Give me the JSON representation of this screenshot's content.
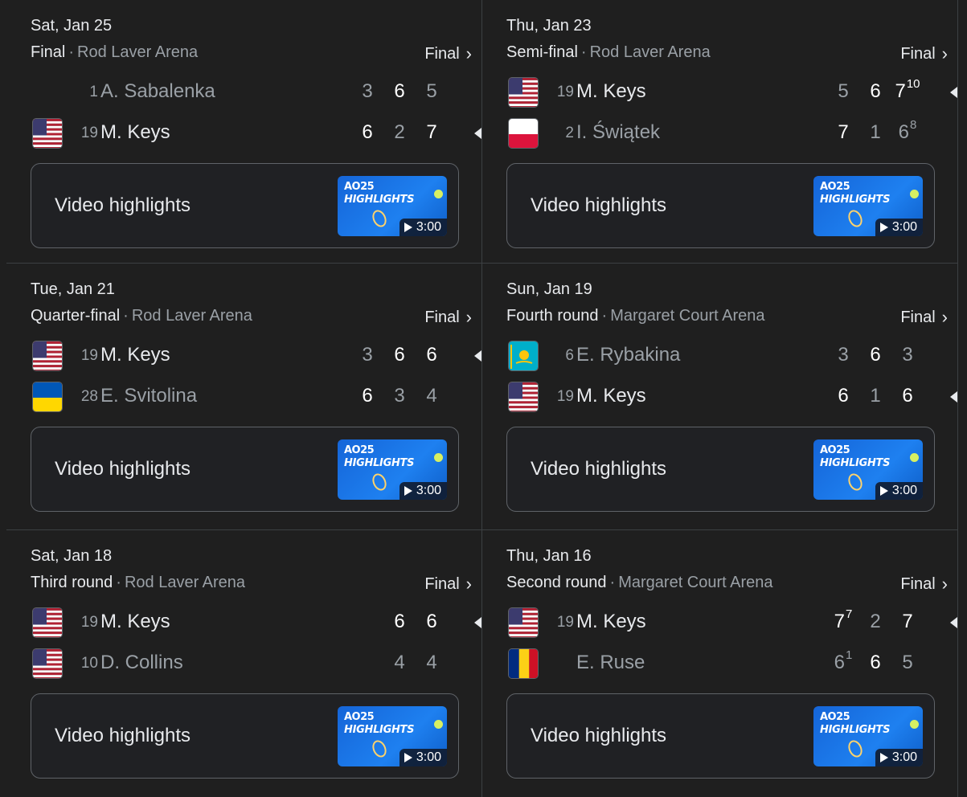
{
  "matches": [
    {
      "date": "Sat, Jan 25",
      "round": "Final",
      "venue": "Rod Laver Arena",
      "status": "Final",
      "players": [
        {
          "flag": "none",
          "seed": "1",
          "name": "A. Sabalenka",
          "winner": false,
          "sets": [
            {
              "v": "3",
              "w": false,
              "tb": ""
            },
            {
              "v": "6",
              "w": true,
              "tb": ""
            },
            {
              "v": "5",
              "w": false,
              "tb": ""
            }
          ]
        },
        {
          "flag": "usa",
          "seed": "19",
          "name": "M. Keys",
          "winner": true,
          "sets": [
            {
              "v": "6",
              "w": true,
              "tb": ""
            },
            {
              "v": "2",
              "w": false,
              "tb": ""
            },
            {
              "v": "7",
              "w": true,
              "tb": ""
            }
          ]
        }
      ],
      "highlights": {
        "label": "Video highlights",
        "badge": "AO25",
        "title": "HIGHLIGHTS",
        "duration": "3:00"
      }
    },
    {
      "date": "Thu, Jan 23",
      "round": "Semi-final",
      "venue": "Rod Laver Arena",
      "status": "Final",
      "players": [
        {
          "flag": "usa",
          "seed": "19",
          "name": "M. Keys",
          "winner": true,
          "sets": [
            {
              "v": "5",
              "w": false,
              "tb": ""
            },
            {
              "v": "6",
              "w": true,
              "tb": ""
            },
            {
              "v": "7",
              "w": true,
              "tb": "10"
            }
          ]
        },
        {
          "flag": "poland",
          "seed": "2",
          "name": "I. Świątek",
          "winner": false,
          "sets": [
            {
              "v": "7",
              "w": true,
              "tb": ""
            },
            {
              "v": "1",
              "w": false,
              "tb": ""
            },
            {
              "v": "6",
              "w": false,
              "tb": "8"
            }
          ]
        }
      ],
      "highlights": {
        "label": "Video highlights",
        "badge": "AO25",
        "title": "HIGHLIGHTS",
        "duration": "3:00"
      }
    },
    {
      "date": "Tue, Jan 21",
      "round": "Quarter-final",
      "venue": "Rod Laver Arena",
      "status": "Final",
      "players": [
        {
          "flag": "usa",
          "seed": "19",
          "name": "M. Keys",
          "winner": true,
          "sets": [
            {
              "v": "3",
              "w": false,
              "tb": ""
            },
            {
              "v": "6",
              "w": true,
              "tb": ""
            },
            {
              "v": "6",
              "w": true,
              "tb": ""
            }
          ]
        },
        {
          "flag": "ukraine",
          "seed": "28",
          "name": "E. Svitolina",
          "winner": false,
          "sets": [
            {
              "v": "6",
              "w": true,
              "tb": ""
            },
            {
              "v": "3",
              "w": false,
              "tb": ""
            },
            {
              "v": "4",
              "w": false,
              "tb": ""
            }
          ]
        }
      ],
      "highlights": {
        "label": "Video highlights",
        "badge": "AO25",
        "title": "HIGHLIGHTS",
        "duration": "3:00"
      }
    },
    {
      "date": "Sun, Jan 19",
      "round": "Fourth round",
      "venue": "Margaret Court Arena",
      "status": "Final",
      "players": [
        {
          "flag": "kazakhstan",
          "seed": "6",
          "name": "E. Rybakina",
          "winner": false,
          "sets": [
            {
              "v": "3",
              "w": false,
              "tb": ""
            },
            {
              "v": "6",
              "w": true,
              "tb": ""
            },
            {
              "v": "3",
              "w": false,
              "tb": ""
            }
          ]
        },
        {
          "flag": "usa",
          "seed": "19",
          "name": "M. Keys",
          "winner": true,
          "sets": [
            {
              "v": "6",
              "w": true,
              "tb": ""
            },
            {
              "v": "1",
              "w": false,
              "tb": ""
            },
            {
              "v": "6",
              "w": true,
              "tb": ""
            }
          ]
        }
      ],
      "highlights": {
        "label": "Video highlights",
        "badge": "AO25",
        "title": "HIGHLIGHTS",
        "duration": "3:00"
      }
    },
    {
      "date": "Sat, Jan 18",
      "round": "Third round",
      "venue": "Rod Laver Arena",
      "status": "Final",
      "players": [
        {
          "flag": "usa",
          "seed": "19",
          "name": "M. Keys",
          "winner": true,
          "sets": [
            {
              "v": "6",
              "w": true,
              "tb": ""
            },
            {
              "v": "6",
              "w": true,
              "tb": ""
            }
          ]
        },
        {
          "flag": "usa",
          "seed": "10",
          "name": "D. Collins",
          "winner": false,
          "sets": [
            {
              "v": "4",
              "w": false,
              "tb": ""
            },
            {
              "v": "4",
              "w": false,
              "tb": ""
            }
          ]
        }
      ],
      "highlights": {
        "label": "Video highlights",
        "badge": "AO25",
        "title": "HIGHLIGHTS",
        "duration": "3:00"
      }
    },
    {
      "date": "Thu, Jan 16",
      "round": "Second round",
      "venue": "Margaret Court Arena",
      "status": "Final",
      "players": [
        {
          "flag": "usa",
          "seed": "19",
          "name": "M. Keys",
          "winner": true,
          "sets": [
            {
              "v": "7",
              "w": true,
              "tb": "7"
            },
            {
              "v": "2",
              "w": false,
              "tb": ""
            },
            {
              "v": "7",
              "w": true,
              "tb": ""
            }
          ]
        },
        {
          "flag": "romania",
          "seed": "",
          "name": "E. Ruse",
          "winner": false,
          "sets": [
            {
              "v": "6",
              "w": false,
              "tb": "1"
            },
            {
              "v": "6",
              "w": true,
              "tb": ""
            },
            {
              "v": "5",
              "w": false,
              "tb": ""
            }
          ]
        }
      ],
      "highlights": {
        "label": "Video highlights",
        "badge": "AO25",
        "title": "HIGHLIGHTS",
        "duration": "3:00"
      }
    }
  ]
}
